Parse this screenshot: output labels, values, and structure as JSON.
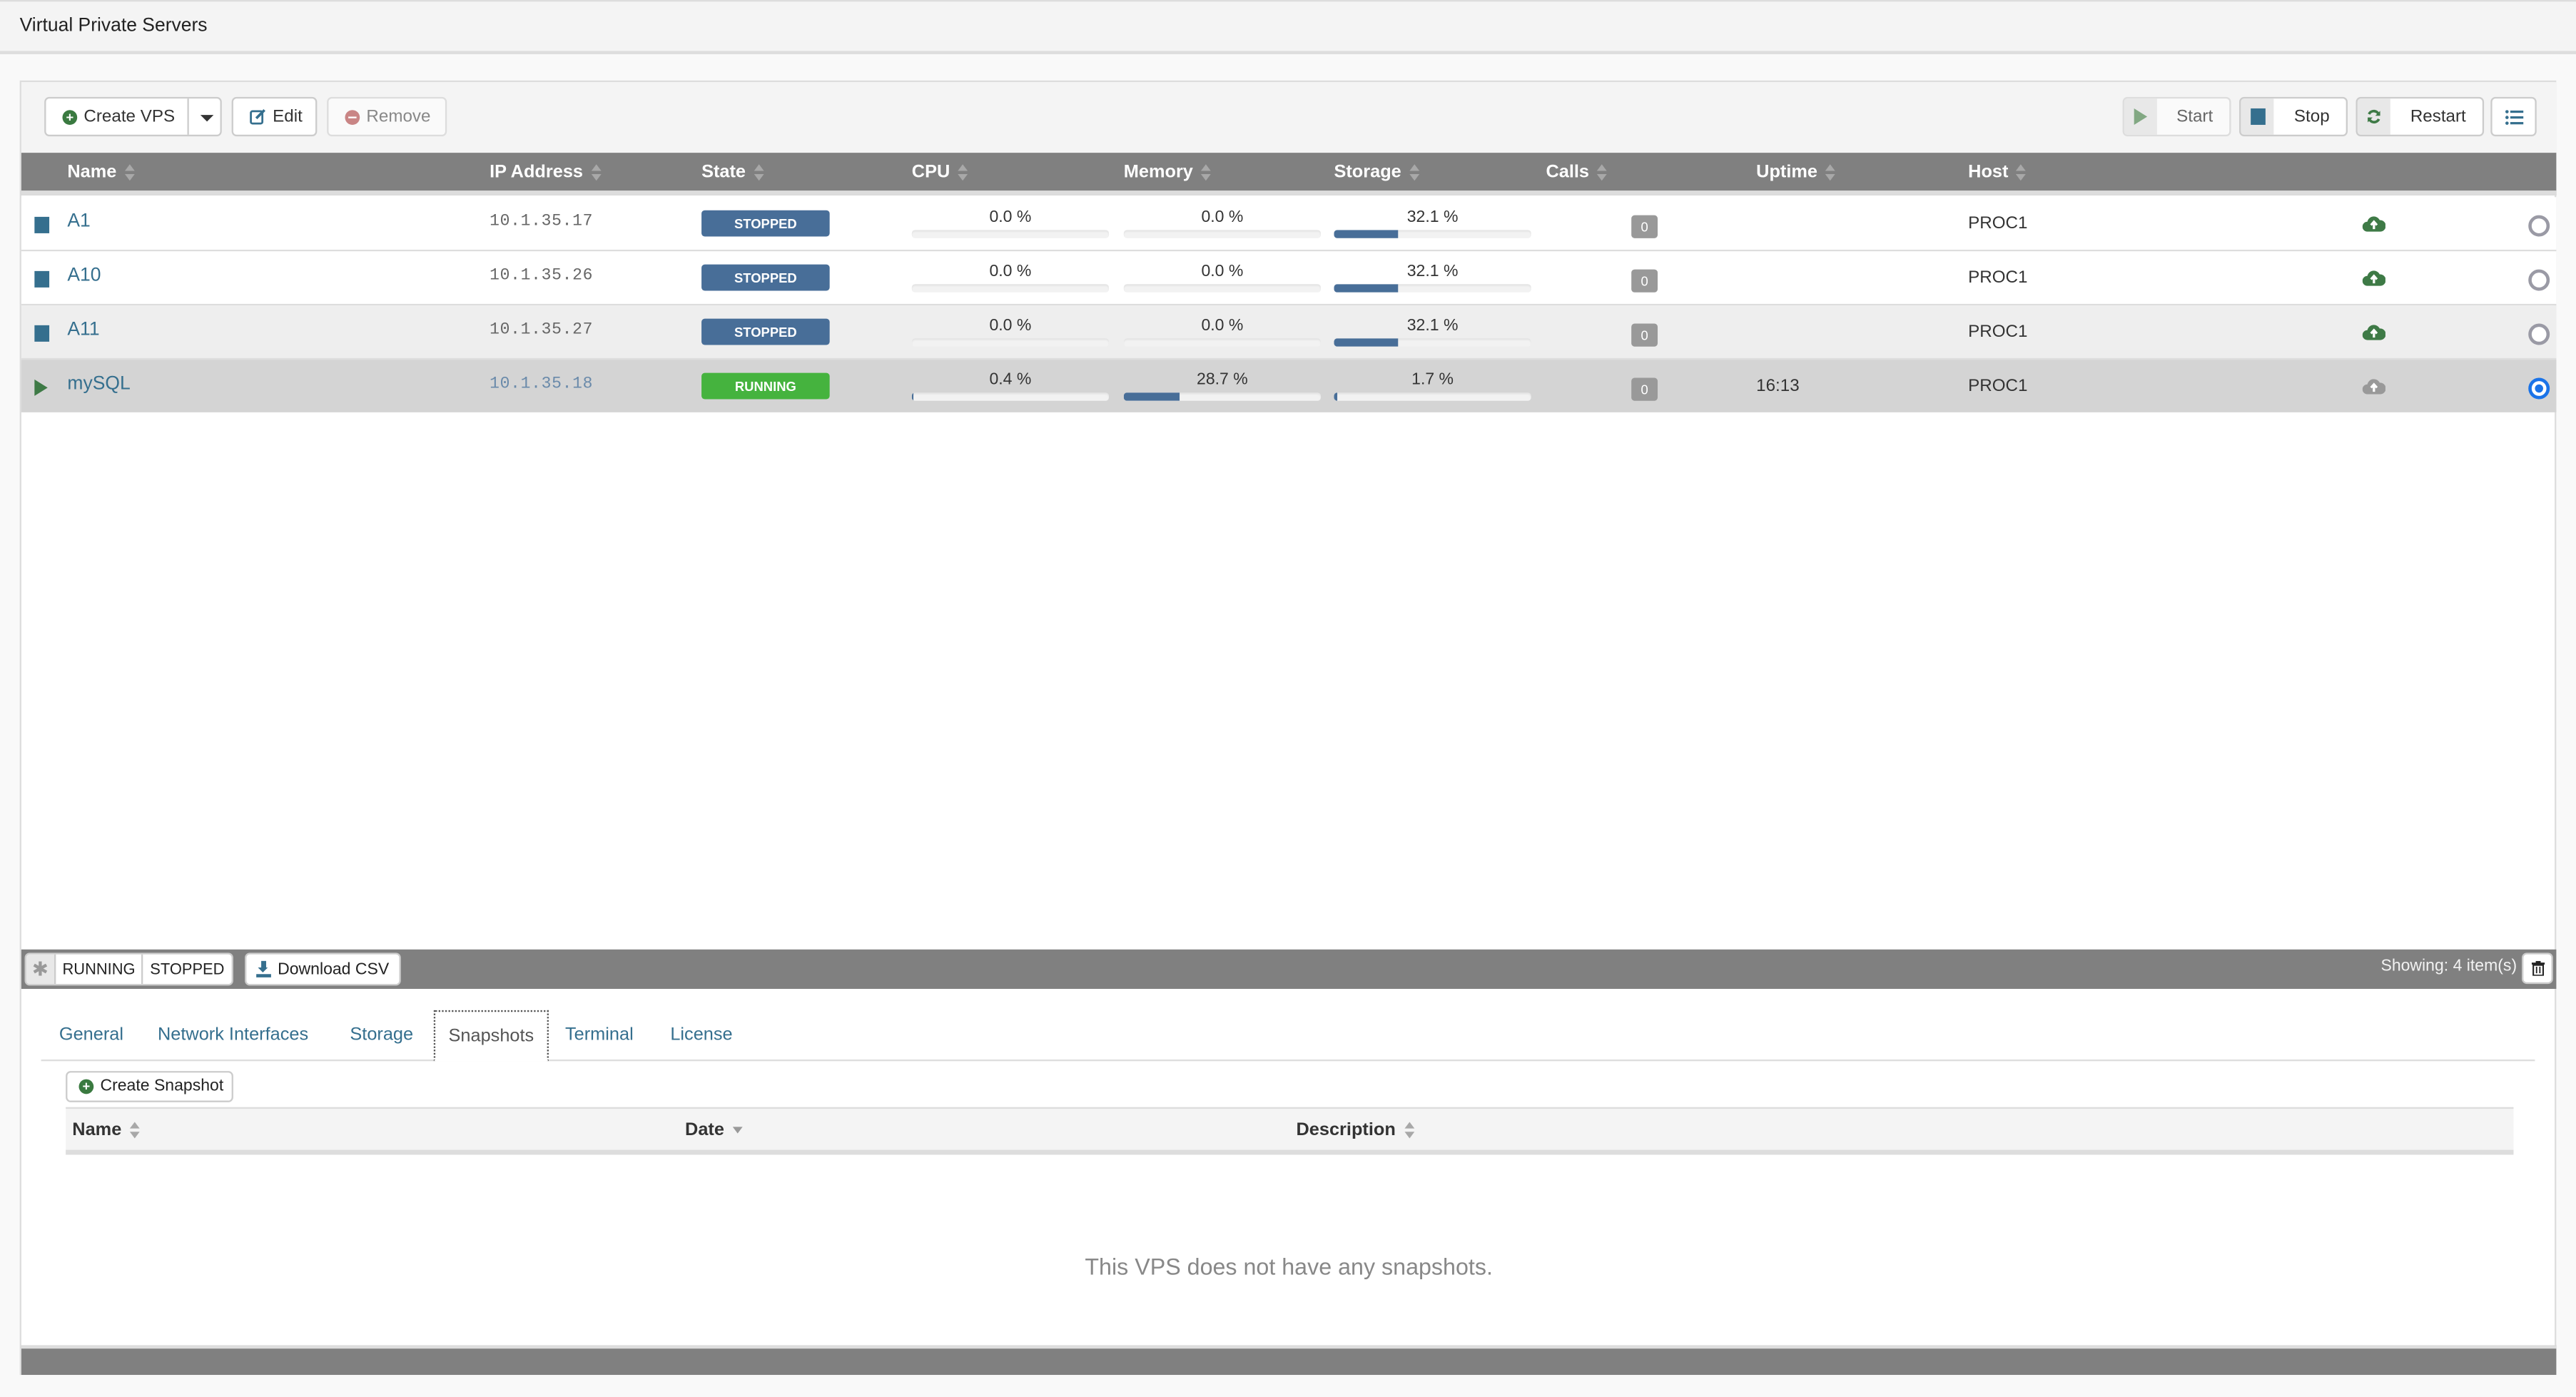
{
  "page": {
    "title": "Virtual Private Servers"
  },
  "toolbar": {
    "create_label": "Create VPS",
    "edit_label": "Edit",
    "remove_label": "Remove",
    "start_label": "Start",
    "stop_label": "Stop",
    "restart_label": "Restart"
  },
  "table": {
    "columns": [
      "Name",
      "IP Address",
      "State",
      "CPU",
      "Memory",
      "Storage",
      "Calls",
      "Uptime",
      "Host"
    ],
    "rows": [
      {
        "name": "A1",
        "ip": "10.1.35.17",
        "state": "STOPPED",
        "cpu_label": "0.0 %",
        "cpu": 0.0,
        "memory_label": "0.0 %",
        "memory": 0.0,
        "storage_label": "32.1 %",
        "storage": 32.1,
        "calls": "0",
        "uptime": "",
        "host": "PROC1",
        "selected": false
      },
      {
        "name": "A10",
        "ip": "10.1.35.26",
        "state": "STOPPED",
        "cpu_label": "0.0 %",
        "cpu": 0.0,
        "memory_label": "0.0 %",
        "memory": 0.0,
        "storage_label": "32.1 %",
        "storage": 32.1,
        "calls": "0",
        "uptime": "",
        "host": "PROC1",
        "selected": false
      },
      {
        "name": "A11",
        "ip": "10.1.35.27",
        "state": "STOPPED",
        "cpu_label": "0.0 %",
        "cpu": 0.0,
        "memory_label": "0.0 %",
        "memory": 0.0,
        "storage_label": "32.1 %",
        "storage": 32.1,
        "calls": "0",
        "uptime": "",
        "host": "PROC1",
        "selected": false
      },
      {
        "name": "mySQL",
        "ip": "10.1.35.18",
        "state": "RUNNING",
        "cpu_label": "0.4 %",
        "cpu": 0.4,
        "memory_label": "28.7 %",
        "memory": 28.7,
        "storage_label": "1.7 %",
        "storage": 1.7,
        "calls": "0",
        "uptime": "16:13",
        "host": "PROC1",
        "selected": true
      }
    ]
  },
  "footer": {
    "filters": [
      "RUNNING",
      "STOPPED"
    ],
    "download_label": "Download CSV",
    "showing": "Showing: 4 item(s)"
  },
  "details": {
    "tabs": [
      "General",
      "Network Interfaces",
      "Storage",
      "Snapshots",
      "Terminal",
      "License"
    ],
    "active_tab": "Snapshots",
    "create_snapshot_label": "Create Snapshot",
    "snapshot_columns": [
      "Name",
      "Date",
      "Description"
    ],
    "empty_message": "This VPS does not have any snapshots."
  },
  "colors": {
    "stopped": "#486e98",
    "running": "#45b33e",
    "link": "#356f8e",
    "header_bar": "#808080",
    "cloud_active": "#3e7a46",
    "cloud_inactive": "#999999",
    "radio_selected": "#1a73e8"
  }
}
